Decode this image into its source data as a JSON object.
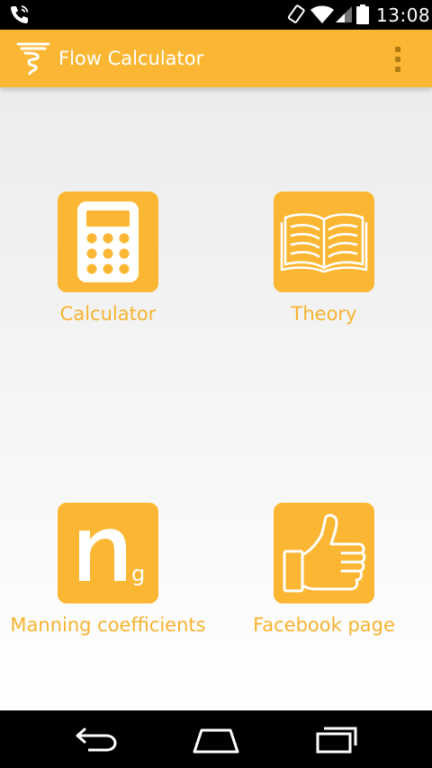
{
  "status_bar": {
    "time": "13:08",
    "icons": [
      "phone-call-icon",
      "screen-rotate-icon",
      "wifi-icon",
      "signal-icon",
      "battery-icon"
    ]
  },
  "action_bar": {
    "title": "Flow Calculator",
    "icon": "tornado-logo-icon",
    "overflow_icon": "overflow-menu-icon"
  },
  "tiles": [
    {
      "label": "Calculator",
      "icon": "calculator-icon"
    },
    {
      "label": "Theory",
      "icon": "open-book-icon"
    },
    {
      "label": "Manning coefficients",
      "icon": "manning-n-icon",
      "icon_text": "n",
      "icon_subscript": "g"
    },
    {
      "label": "Facebook page",
      "icon": "thumbs-up-icon"
    }
  ],
  "nav_bar": {
    "icons": [
      "back-icon",
      "home-icon",
      "recent-apps-icon"
    ]
  },
  "colors": {
    "accent": "#fbb733",
    "label": "#f6b32f",
    "overflow_dots": "#b07c12"
  }
}
